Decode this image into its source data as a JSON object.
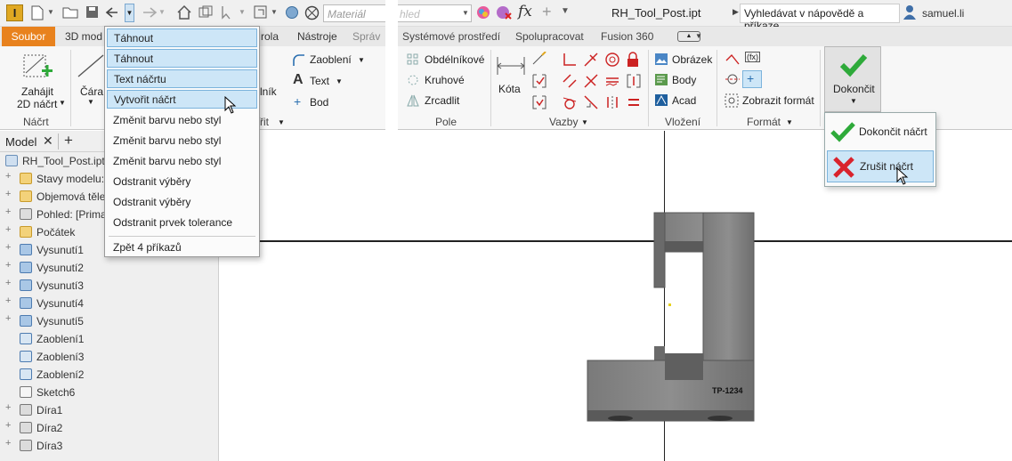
{
  "app": {
    "logo_letter": "I",
    "material_placeholder": "Materiál",
    "appearance_placeholder": "hled",
    "fx_label": "fx",
    "doc_title": "RH_Tool_Post.ipt",
    "search_label": "Vyhledávat v nápovědě a příkaze",
    "user": "samuel.li"
  },
  "tabs": {
    "left": [
      {
        "label": "Soubor",
        "active": true
      },
      {
        "label": "3D mod"
      },
      {
        "label": "rola"
      },
      {
        "label": "Nástroje"
      },
      {
        "label": "Správ"
      }
    ],
    "right": [
      {
        "label": "Systémové prostředí"
      },
      {
        "label": "Spolupracovat"
      },
      {
        "label": "Fusion 360"
      }
    ]
  },
  "ribbon": {
    "start_sketch": "Zahájit\n2D náčrt",
    "start_sketch_line1": "Zahájit",
    "start_sketch_line2": "2D náčrt",
    "group_sketch": "Náčrt",
    "line": "Čára",
    "fillet": "Zaoblení",
    "text": "Text",
    "point": "Bod",
    "partial_right": "lník",
    "partial_group": "řit",
    "rect_pattern": "Obdélníkové",
    "circ_pattern": "Kruhové",
    "mirror": "Zrcadlit",
    "group_pattern": "Pole",
    "dimension": "Kóta",
    "group_constraints": "Vazby",
    "image": "Obrázek",
    "points": "Body",
    "acad": "Acad",
    "group_insert": "Vložení",
    "show_format": "Zobrazit formát",
    "group_format": "Formát",
    "finish": "Dokončit"
  },
  "model_tab": {
    "label": "Model",
    "add": "+"
  },
  "tree": [
    {
      "label": "RH_Tool_Post.ipt",
      "expander": "",
      "icon": "part-icon"
    },
    {
      "label": "Stavy modelu:",
      "expander": "+",
      "icon": "folder-icon"
    },
    {
      "label": "Objemová těle",
      "expander": "+",
      "icon": "folder-icon"
    },
    {
      "label": "Pohled: [Prima",
      "expander": "+",
      "icon": "view-icon"
    },
    {
      "label": "Počátek",
      "expander": "+",
      "icon": "folder-icon"
    },
    {
      "label": "Vysunutí1",
      "expander": "+",
      "icon": "extrude-icon"
    },
    {
      "label": "Vysunutí2",
      "expander": "+",
      "icon": "extrude-icon"
    },
    {
      "label": "Vysunutí3",
      "expander": "+",
      "icon": "extrude-icon"
    },
    {
      "label": "Vysunutí4",
      "expander": "+",
      "icon": "extrude-icon"
    },
    {
      "label": "Vysunutí5",
      "expander": "+",
      "icon": "extrude-icon"
    },
    {
      "label": "Zaoblení1",
      "expander": "",
      "icon": "fillet-icon"
    },
    {
      "label": "Zaoblení3",
      "expander": "",
      "icon": "fillet-icon"
    },
    {
      "label": "Zaoblení2",
      "expander": "",
      "icon": "fillet-icon"
    },
    {
      "label": "Sketch6",
      "expander": "",
      "icon": "sketch-icon"
    },
    {
      "label": "Díra1",
      "expander": "+",
      "icon": "hole-icon"
    },
    {
      "label": "Díra2",
      "expander": "+",
      "icon": "hole-icon"
    },
    {
      "label": "Díra3",
      "expander": "+",
      "icon": "hole-icon"
    }
  ],
  "undo_menu": {
    "items": [
      {
        "label": "Táhnout",
        "highlight": true
      },
      {
        "label": "Táhnout",
        "highlight": true
      },
      {
        "label": "Text náčrtu",
        "highlight": true
      },
      {
        "label": "Vytvořit náčrt",
        "highlight": true
      },
      {
        "label": "Změnit barvu nebo styl"
      },
      {
        "label": "Změnit barvu nebo styl"
      },
      {
        "label": "Změnit barvu nebo styl"
      },
      {
        "label": "Odstranit výběry"
      },
      {
        "label": "Odstranit výběry"
      },
      {
        "label": "Odstranit prvek tolerance"
      }
    ],
    "footer": "Zpět 4 příkazů"
  },
  "finish_menu": {
    "finish_sketch": "Dokončit náčrt",
    "cancel_sketch": "Zrušit náčrt"
  },
  "model_text": "TP-1234",
  "colors": {
    "accent_tab": "#e8821e",
    "highlight": "#cde6f7",
    "check_green": "#2eaa3a",
    "cancel_red": "#d9232d"
  }
}
